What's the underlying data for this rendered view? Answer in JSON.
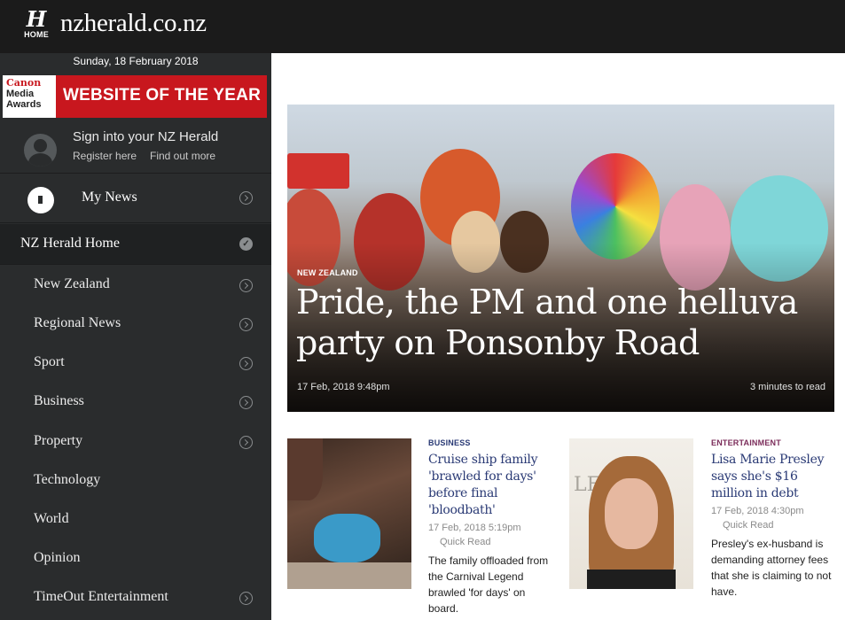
{
  "header": {
    "logo_letter": "H",
    "logo_home": "HOME",
    "site_name": "nzherald.co.nz"
  },
  "sidebar": {
    "date": "Sunday, 18 February 2018",
    "award": {
      "logo_line1": "Canon",
      "logo_line2": "Media",
      "logo_line3": "Awards",
      "text": "WEBSITE OF THE YEAR"
    },
    "signin": {
      "title": "Sign into your NZ Herald",
      "register": "Register here",
      "find_out": "Find out more"
    },
    "my_news": "My News",
    "home": "NZ Herald Home",
    "items": [
      {
        "label": "New Zealand",
        "chevron": true
      },
      {
        "label": "Regional News",
        "chevron": true
      },
      {
        "label": "Sport",
        "chevron": true
      },
      {
        "label": "Business",
        "chevron": true
      },
      {
        "label": "Property",
        "chevron": true
      },
      {
        "label": "Technology",
        "chevron": false
      },
      {
        "label": "World",
        "chevron": false
      },
      {
        "label": "Opinion",
        "chevron": false
      },
      {
        "label": "TimeOut Entertainment",
        "chevron": true
      }
    ]
  },
  "hero": {
    "category": "NEW ZEALAND",
    "title": "Pride, the PM and one helluva party on Ponsonby Road",
    "date": "17 Feb, 2018 9:48pm",
    "read_time": "3 minutes to read"
  },
  "stories": [
    {
      "category": "BUSINESS",
      "category_color": "#2a3a75",
      "title": "Cruise ship family 'brawled for days' before final 'bloodbath'",
      "date": "17 Feb, 2018 5:19pm",
      "quick_read": "Quick Read",
      "summary": "The family offloaded from the Carnival Legend brawled 'for days' on board."
    },
    {
      "category": "ENTERTAINMENT",
      "category_color": "#7b2c5a",
      "title": "Lisa Marie Presley says she's $16 million in debt",
      "date": "17 Feb, 2018 4:30pm",
      "quick_read": "Quick Read",
      "summary": "Presley's ex-husband is demanding attorney fees that she is claiming to not have."
    }
  ]
}
